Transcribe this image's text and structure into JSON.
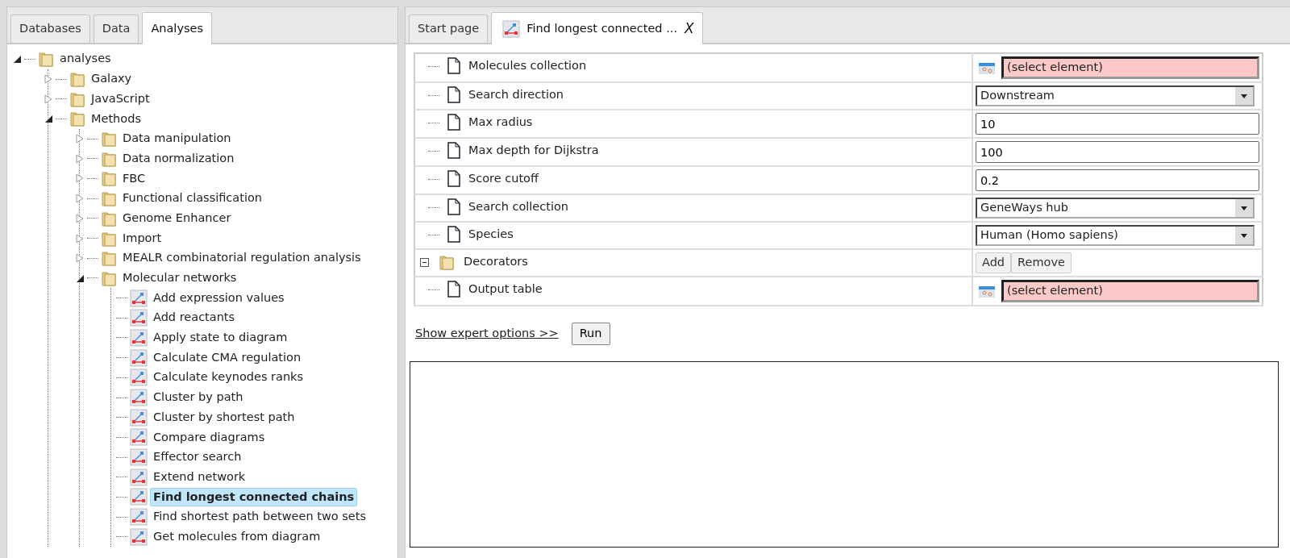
{
  "left_tabs": [
    {
      "label": "Databases",
      "selected": false
    },
    {
      "label": "Data",
      "selected": false
    },
    {
      "label": "Analyses",
      "selected": true
    }
  ],
  "tree": [
    {
      "label": "analyses",
      "kind": "folder",
      "expanded": true,
      "selected": false,
      "children": [
        {
          "label": "Galaxy",
          "kind": "folder",
          "expanded": false,
          "selected": false
        },
        {
          "label": "JavaScript",
          "kind": "folder",
          "expanded": false,
          "selected": false
        },
        {
          "label": "Methods",
          "kind": "folder",
          "expanded": true,
          "selected": false,
          "children": [
            {
              "label": "Data manipulation",
              "kind": "folder",
              "expanded": false,
              "selected": false
            },
            {
              "label": "Data normalization",
              "kind": "folder",
              "expanded": false,
              "selected": false
            },
            {
              "label": "FBC",
              "kind": "folder",
              "expanded": false,
              "selected": false
            },
            {
              "label": "Functional classification",
              "kind": "folder",
              "expanded": false,
              "selected": false
            },
            {
              "label": "Genome Enhancer",
              "kind": "folder",
              "expanded": false,
              "selected": false
            },
            {
              "label": "Import",
              "kind": "folder",
              "expanded": false,
              "selected": false
            },
            {
              "label": "MEALR combinatorial regulation analysis",
              "kind": "folder",
              "expanded": false,
              "selected": false
            },
            {
              "label": "Molecular networks",
              "kind": "folder",
              "expanded": true,
              "selected": false,
              "children": [
                {
                  "label": "Add expression values",
                  "kind": "method",
                  "selected": false
                },
                {
                  "label": "Add reactants",
                  "kind": "method",
                  "selected": false
                },
                {
                  "label": "Apply state to diagram",
                  "kind": "method",
                  "selected": false
                },
                {
                  "label": "Calculate CMA regulation",
                  "kind": "method",
                  "selected": false
                },
                {
                  "label": "Calculate keynodes ranks",
                  "kind": "method",
                  "selected": false
                },
                {
                  "label": "Cluster by path",
                  "kind": "method",
                  "selected": false
                },
                {
                  "label": "Cluster by shortest path",
                  "kind": "method",
                  "selected": false
                },
                {
                  "label": "Compare diagrams",
                  "kind": "method",
                  "selected": false
                },
                {
                  "label": "Effector search",
                  "kind": "method",
                  "selected": false
                },
                {
                  "label": "Extend network",
                  "kind": "method",
                  "selected": false
                },
                {
                  "label": "Find longest connected chains",
                  "kind": "method",
                  "selected": true
                },
                {
                  "label": "Find shortest path between two sets",
                  "kind": "method",
                  "selected": false
                },
                {
                  "label": "Get molecules from diagram",
                  "kind": "method",
                  "selected": false
                }
              ]
            }
          ]
        }
      ]
    }
  ],
  "right_tabs": [
    {
      "label": "Start page",
      "selected": false,
      "kind": "plain"
    },
    {
      "label": "Find longest connected ...",
      "selected": true,
      "kind": "analysis",
      "close": "X"
    }
  ],
  "parameters": [
    {
      "label": "Molecules collection",
      "kind": "element",
      "value": "(select element)"
    },
    {
      "label": "Search direction",
      "kind": "select",
      "value": "Downstream"
    },
    {
      "label": "Max radius",
      "kind": "text",
      "value": "10"
    },
    {
      "label": "Max depth for Dijkstra",
      "kind": "text",
      "value": "100"
    },
    {
      "label": "Score cutoff",
      "kind": "text",
      "value": "0.2"
    },
    {
      "label": "Search collection",
      "kind": "select",
      "value": "GeneWays hub"
    },
    {
      "label": "Species",
      "kind": "select",
      "value": "Human (Homo sapiens)"
    },
    {
      "label": "Decorators",
      "kind": "group",
      "expanded": true,
      "buttons": [
        "Add",
        "Remove"
      ]
    },
    {
      "label": "Output table",
      "kind": "element",
      "value": "(select element)"
    }
  ],
  "expert_link": "Show expert options >>",
  "run_button": "Run"
}
